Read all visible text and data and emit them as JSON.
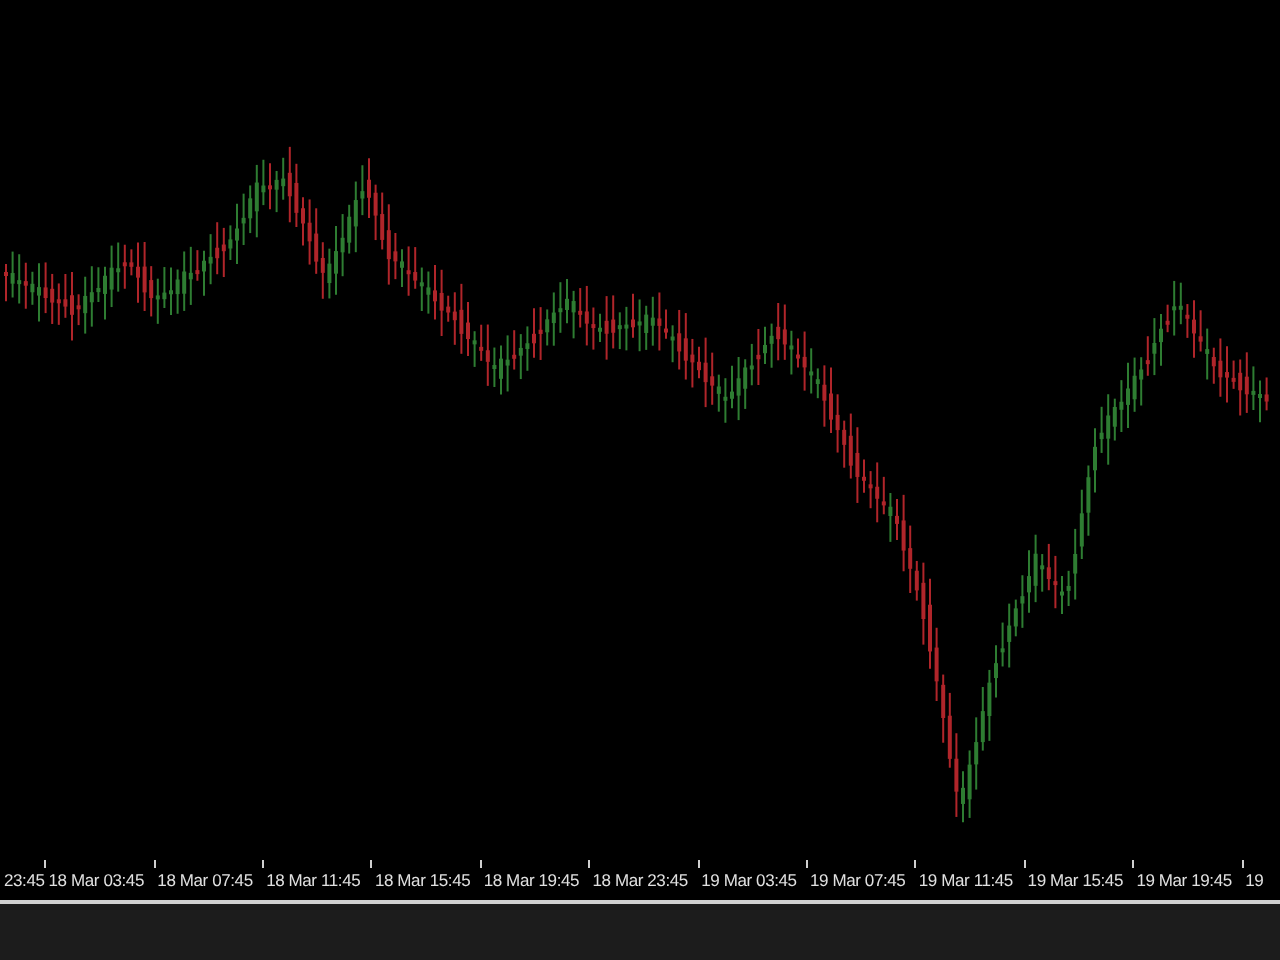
{
  "time_axis": {
    "labels": [
      "23:45",
      "18 Mar 03:45",
      "18 Mar 07:45",
      "18 Mar 11:45",
      "18 Mar 15:45",
      "18 Mar 19:45",
      "18 Mar 23:45",
      "19 Mar 03:45",
      "19 Mar 07:45",
      "19 Mar 11:45",
      "19 Mar 15:45",
      "19 Mar 19:45",
      "19"
    ]
  }
}
